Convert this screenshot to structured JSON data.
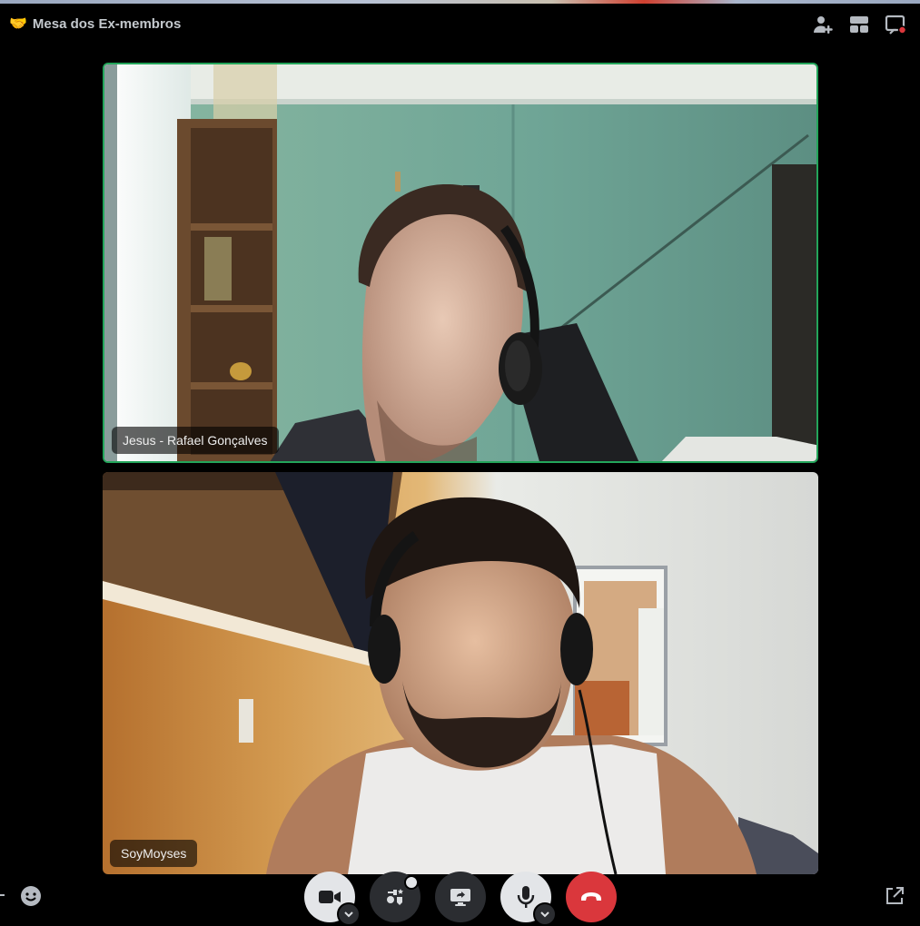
{
  "header": {
    "channel_emoji": "🤝",
    "channel_name": "Mesa dos Ex-membros",
    "icons": [
      "add-user-icon",
      "layout-grid-icon",
      "activity-screen-icon"
    ]
  },
  "participants": [
    {
      "name": "Jesus - Rafael Gonçalves",
      "speaking": true
    },
    {
      "name": "SoyMoyses",
      "speaking": false
    }
  ],
  "controls": {
    "buttons": [
      "camera",
      "activities",
      "screen-share",
      "microphone",
      "disconnect"
    ]
  },
  "colors": {
    "speaking_border": "#23a55a",
    "disconnect": "#da373c",
    "notification": "#da373c"
  }
}
